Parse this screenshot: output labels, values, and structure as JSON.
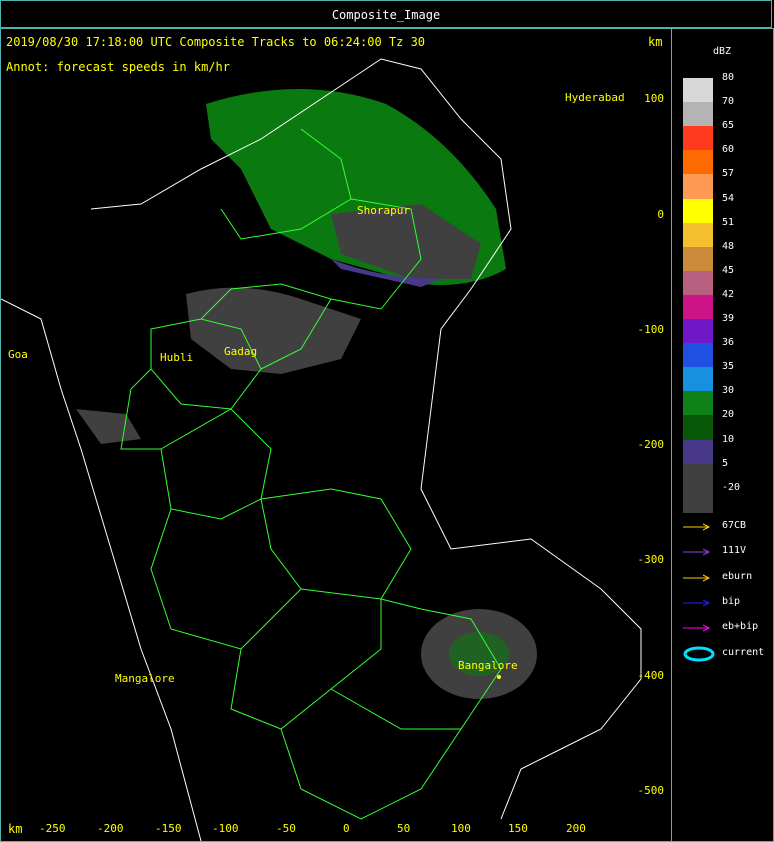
{
  "window": {
    "title": "Composite_Image"
  },
  "header": {
    "line1": "2019/08/30 17:18:00 UTC Composite Tracks to 06:24:00 Tz 30",
    "line2": "Annot: forecast speeds in km/hr",
    "unit_top": "km",
    "unit_bottom": "km"
  },
  "axes": {
    "x_ticks": [
      "-250",
      "-200",
      "-150",
      "-100",
      "-50",
      "0",
      "50",
      "100",
      "150",
      "200"
    ],
    "y_ticks": [
      "100",
      "0",
      "-100",
      "-200",
      "-300",
      "-400",
      "-500"
    ]
  },
  "cities": [
    {
      "name": "Hyderabad"
    },
    {
      "name": "Shorapur"
    },
    {
      "name": "Goa"
    },
    {
      "name": "Hubli"
    },
    {
      "name": "Gadag"
    },
    {
      "name": "Bangalore"
    },
    {
      "name": "Mangalore"
    }
  ],
  "legend": {
    "unit": "dBZ",
    "levels": [
      {
        "label": "80",
        "color": "#d8d8d8"
      },
      {
        "label": "70",
        "color": "#b4b4b4"
      },
      {
        "label": "65",
        "color": "#ff3a1e"
      },
      {
        "label": "60",
        "color": "#ff6a00"
      },
      {
        "label": "57",
        "color": "#ff9a55"
      },
      {
        "label": "54",
        "color": "#ffff00"
      },
      {
        "label": "51",
        "color": "#f5c030"
      },
      {
        "label": "48",
        "color": "#cc8a3a"
      },
      {
        "label": "45",
        "color": "#b86080"
      },
      {
        "label": "42",
        "color": "#cc1488"
      },
      {
        "label": "39",
        "color": "#7018c8"
      },
      {
        "label": "36",
        "color": "#2050e0"
      },
      {
        "label": "35",
        "color": "#1890e0"
      },
      {
        "label": "30",
        "color": "#108018"
      },
      {
        "label": "20",
        "color": "#085808"
      },
      {
        "label": "10",
        "color": "#483888"
      },
      {
        "label": "5",
        "color": "#404040"
      },
      {
        "label": "-20",
        "color": "#404040"
      }
    ],
    "tracks": [
      {
        "label": "67CB",
        "color": "#ffcc00"
      },
      {
        "label": "111V",
        "color": "#9040e0"
      },
      {
        "label": "eburn",
        "color": "#ffcc00"
      },
      {
        "label": "bip",
        "color": "#2020ff"
      },
      {
        "label": "eb+bip",
        "color": "#ff00ff"
      },
      {
        "label": "current",
        "color": "#00e0ff"
      }
    ]
  }
}
